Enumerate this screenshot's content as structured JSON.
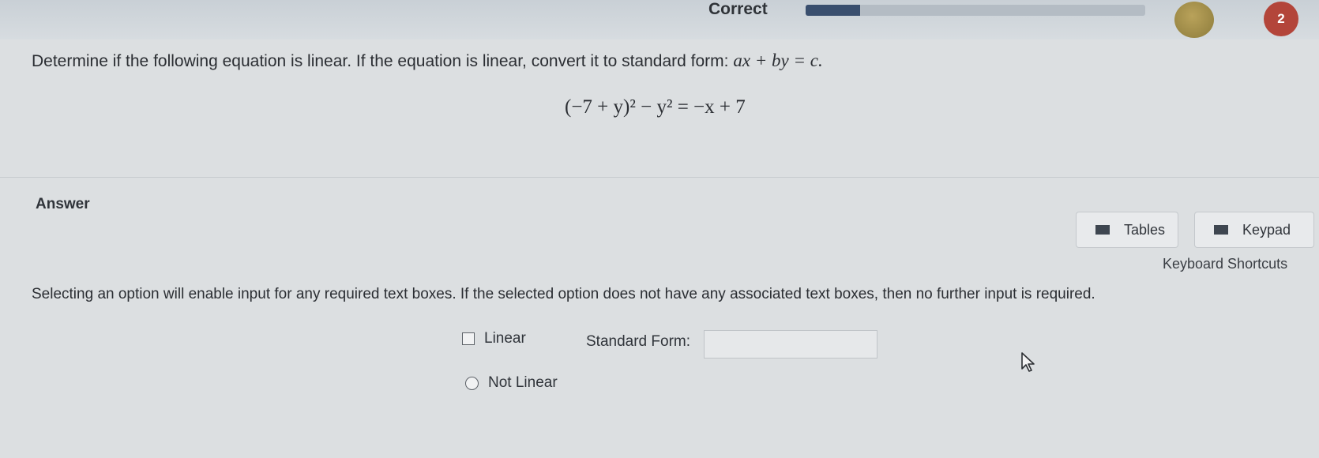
{
  "header": {
    "status": "Correct",
    "progress": 0.16,
    "counter": "2",
    "colors": {
      "progress": "#3a4f6e",
      "badge_gold": "#a08e48",
      "badge_red": "#b3453a"
    }
  },
  "question": {
    "prompt": "Determine if the following equation is linear. If the equation is linear, convert it to standard form:",
    "standard_form": "ax + by = c.",
    "equation": "(−7 + y)² − y² = −x + 7"
  },
  "answer": {
    "heading": "Answer",
    "tables_label": "Tables",
    "keypad_label": "Keypad",
    "shortcuts_label": "Keyboard Shortcuts",
    "instructions": "Selecting an option will enable input for any required text boxes. If the selected option does not have any associated text boxes, then no further input is required.",
    "option_linear": "Linear",
    "standard_form_label": "Standard Form:",
    "standard_form_value": "",
    "option_not_linear": "Not Linear"
  },
  "icons": [
    "table-icon",
    "keypad-icon",
    "checkbox-icon",
    "radio-icon",
    "mouse-cursor-icon"
  ]
}
